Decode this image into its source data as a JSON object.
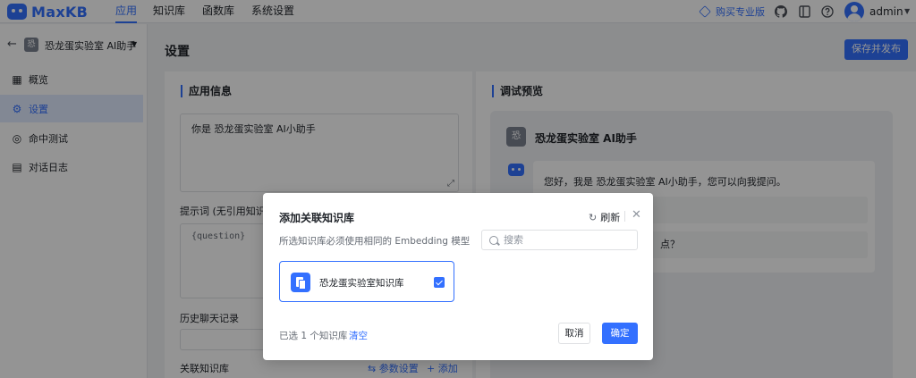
{
  "app": {
    "logo_text": "MaxKB"
  },
  "nav": {
    "items": [
      {
        "label": "应用",
        "active": true
      },
      {
        "label": "知识库",
        "active": false
      },
      {
        "label": "函数库",
        "active": false
      },
      {
        "label": "系统设置",
        "active": false
      }
    ],
    "buy_label": "购买专业版",
    "user_name": "admin"
  },
  "sidebar": {
    "app_badge": "恐",
    "app_name": "恐龙蛋实验室 AI助手",
    "items": [
      {
        "label": "概览",
        "icon": "grid-icon",
        "active": false
      },
      {
        "label": "设置",
        "icon": "gear-icon",
        "active": true
      },
      {
        "label": "命中测试",
        "icon": "target-icon",
        "active": false
      },
      {
        "label": "对话日志",
        "icon": "log-icon",
        "active": false
      }
    ]
  },
  "main": {
    "title": "设置",
    "save_label": "保存并发布",
    "app_info": {
      "heading": "应用信息",
      "prompt_text": "你是 恐龙蛋实验室 AI小助手",
      "prompt_label": "提示词 (无引用知识库",
      "prompt_template": "{question}",
      "history_label": "历史聊天记录",
      "kb_label": "关联知识库",
      "param_settings": "参数设置",
      "add_label": "+ 添加"
    },
    "preview": {
      "heading": "调试预览",
      "badge": "恐",
      "bot_name": "恐龙蛋实验室 AI助手",
      "greeting": "您好，我是 恐龙蛋实验室 AI小助手，您可以向我提问。",
      "suggestion_tail": "点？"
    }
  },
  "dialog": {
    "title": "添加关联知识库",
    "refresh_label": "刷新",
    "hint": "所选知识库必须使用相同的 Embedding 模型",
    "search_placeholder": "搜索",
    "kb_items": [
      {
        "name": "恐龙蛋实验室知识库",
        "checked": true
      }
    ],
    "selected_text": "已选 1 个知识库",
    "clear_label": "清空",
    "cancel_label": "取消",
    "ok_label": "确定"
  },
  "colors": {
    "accent": "#3370ff",
    "text": "#1f2329",
    "muted": "#646a73"
  }
}
